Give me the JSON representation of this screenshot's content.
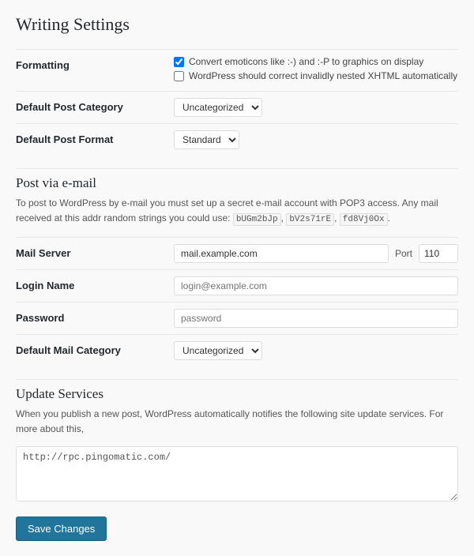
{
  "page": {
    "title": "Writing Settings"
  },
  "formatting": {
    "label": "Formatting",
    "checkbox1_label": "Convert emoticons like :-) and :-P to graphics on display",
    "checkbox1_checked": true,
    "checkbox2_label": "WordPress should correct invalidly nested XHTML automatically",
    "checkbox2_checked": false
  },
  "default_post_category": {
    "label": "Default Post Category",
    "selected": "Uncategorized",
    "options": [
      "Uncategorized"
    ]
  },
  "default_post_format": {
    "label": "Default Post Format",
    "selected": "Standard",
    "options": [
      "Standard"
    ]
  },
  "post_via_email": {
    "section_title": "Post via e-mail",
    "section_desc": "To post to WordPress by e-mail you must set up a secret e-mail account with POP3 access. Any mail received at this addr random strings you could use:",
    "random_strings": [
      "bUGm2bJp",
      "bV2s71rE",
      "fd8Vj0Ox"
    ]
  },
  "mail_server": {
    "label": "Mail Server",
    "value": "mail.example.com",
    "placeholder": "mail.example.com",
    "port_label": "Port",
    "port_value": "110"
  },
  "login_name": {
    "label": "Login Name",
    "placeholder": "login@example.com"
  },
  "password": {
    "label": "Password",
    "placeholder": "password"
  },
  "default_mail_category": {
    "label": "Default Mail Category",
    "selected": "Uncategorized",
    "options": [
      "Uncategorized"
    ]
  },
  "update_services": {
    "section_title": "Update Services",
    "section_desc": "When you publish a new post, WordPress automatically notifies the following site update services. For more about this,",
    "textarea_value": "http://rpc.pingomatic.com/"
  },
  "save_button": {
    "label": "Save Changes"
  }
}
